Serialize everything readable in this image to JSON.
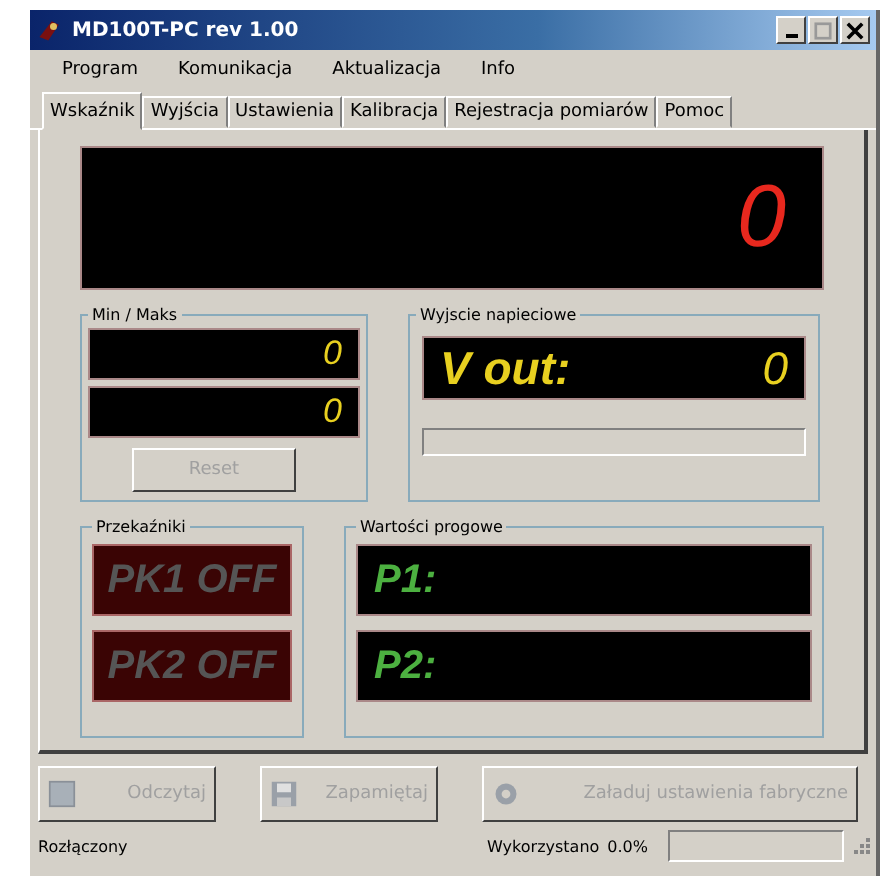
{
  "window": {
    "title": "MD100T-PC rev 1.00"
  },
  "menu": [
    "Program",
    "Komunikacja",
    "Aktualizacja",
    "Info"
  ],
  "tabs": [
    {
      "label": "Wskaźnik",
      "selected": true
    },
    {
      "label": "Wyjścia",
      "selected": false
    },
    {
      "label": "Ustawienia",
      "selected": false
    },
    {
      "label": "Kalibracja",
      "selected": false
    },
    {
      "label": "Rejestracja pomiarów",
      "selected": false
    },
    {
      "label": "Pomoc",
      "selected": false
    }
  ],
  "main_display": "0",
  "min_max": {
    "title": "Min / Maks",
    "values": [
      "0",
      "0"
    ],
    "reset": {
      "label": "Reset",
      "disabled": true
    }
  },
  "voltage_output": {
    "title": "Wyjscie napieciowe",
    "label": "V out:",
    "value": "0",
    "level": 0
  },
  "relays": {
    "title": "Przekaźniki",
    "items": [
      {
        "label": "PK1 OFF",
        "on": false
      },
      {
        "label": "PK2 OFF",
        "on": false
      }
    ]
  },
  "thresholds": {
    "title": "Wartości progowe",
    "items": [
      "P1:",
      "P2:"
    ]
  },
  "buttons": [
    {
      "label": "Odczytaj",
      "kind": "download",
      "disabled": true
    },
    {
      "label": "Zapamiętaj",
      "kind": "save",
      "disabled": true
    },
    {
      "label": "Załaduj ustawienia fabryczne",
      "kind": "factory",
      "disabled": true
    }
  ],
  "status_bar": {
    "status": "Rozłączony",
    "usage_label": "Wykorzystano",
    "usage_value": "0.0%",
    "level": 0
  }
}
